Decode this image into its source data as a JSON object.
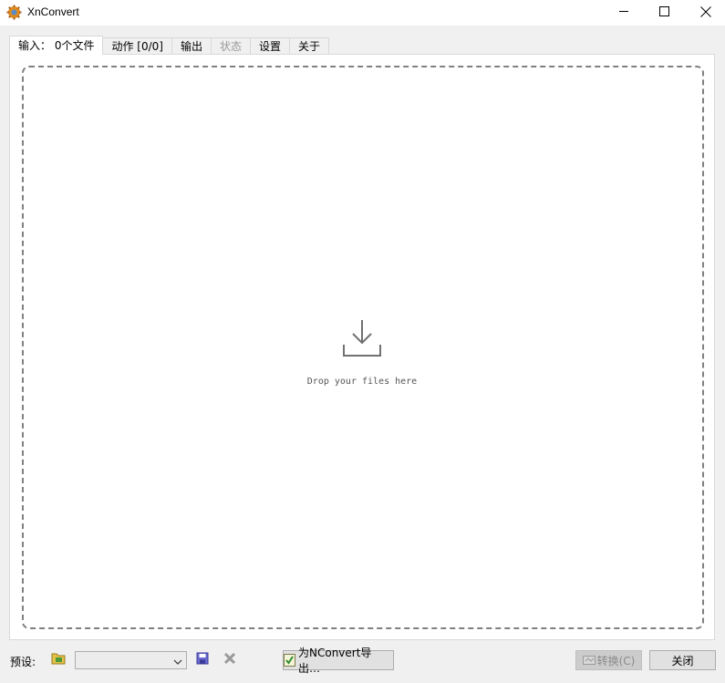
{
  "window": {
    "title": "XnConvert"
  },
  "tabs": [
    {
      "label": "输入： 0个文件",
      "active": true
    },
    {
      "label": "动作 [0/0]"
    },
    {
      "label": "输出"
    },
    {
      "label": "状态",
      "disabled": true
    },
    {
      "label": "设置"
    },
    {
      "label": "关于"
    }
  ],
  "dropzone": {
    "text": "Drop your files here",
    "icon": "download-tray-icon"
  },
  "bottom": {
    "preset_label": "预设:",
    "preset_value": "",
    "export_label": "为NConvert导出…",
    "convert_label": "转换(C)",
    "close_label": "关闭"
  },
  "icons": {
    "app": "xnconvert-logo-icon",
    "open_preset": "folder-open-icon",
    "save_preset": "floppy-disk-icon",
    "delete_preset": "delete-x-icon",
    "export": "export-script-icon",
    "convert": "convert-icon"
  }
}
